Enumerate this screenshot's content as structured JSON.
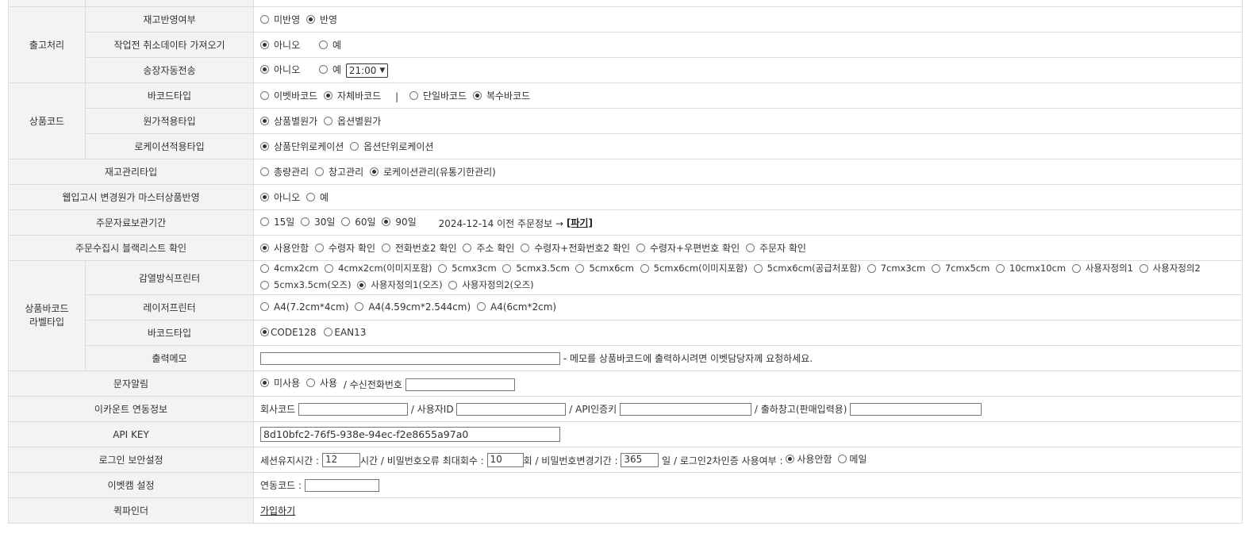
{
  "groups": {
    "shipping": "출고처리",
    "product_code": "상품코드",
    "barcode_label": "상품바코드\n라벨타입"
  },
  "rows": {
    "stock_reflect": {
      "label": "재고반영여부",
      "options": [
        "미반영",
        "반영"
      ]
    },
    "fetch_cancel": {
      "label": "작업전 취소데이타 가져오기",
      "options": [
        "아니오",
        "예"
      ]
    },
    "auto_invoice": {
      "label": "송장자동전송",
      "options": [
        "아니오",
        "예"
      ],
      "time_value": "21:00"
    },
    "barcode_type": {
      "label": "바코드타입",
      "options": [
        "이벳바코드",
        "자체바코드",
        "단일바코드",
        "복수바코드"
      ],
      "divider": "|"
    },
    "cost_type": {
      "label": "원가적용타입",
      "options": [
        "상품별원가",
        "옵션별원가"
      ]
    },
    "location_type": {
      "label": "로케이션적용타입",
      "options": [
        "상품단위로케이션",
        "옵션단위로케이션"
      ]
    },
    "stock_mgmt": {
      "label": "재고관리타입",
      "options": [
        "총량관리",
        "창고관리",
        "로케이션관리(유통기한관리)"
      ]
    },
    "webimport_cost": {
      "label": "웹입고시 변경원가 마스터상품반영",
      "options": [
        "아니오",
        "예"
      ]
    },
    "order_retention": {
      "label": "주문자료보관기간",
      "options": [
        "15일",
        "30일",
        "60일",
        "90일"
      ],
      "note": "2024-12-14 이전 주문정보 →",
      "discard_link": "[파기]"
    },
    "blacklist": {
      "label": "주문수집시 블랙리스트 확인",
      "options": [
        "사용안함",
        "수령자 확인",
        "전화번호2 확인",
        "주소 확인",
        "수령자+전화번호2 확인",
        "수령자+우편번호 확인",
        "주문자 확인"
      ]
    },
    "thermal_printer": {
      "label": "감열방식프린터",
      "options": [
        "4cmx2cm",
        "4cmx2cm(이미지포함)",
        "5cmx3cm",
        "5cmx3.5cm",
        "5cmx6cm",
        "5cmx6cm(이미지포함)",
        "5cmx6cm(공급처포함)",
        "7cmx3cm",
        "7cmx5cm",
        "10cmx10cm",
        "사용자정의1",
        "사용자정의2",
        "5cmx3.5cm(오즈)",
        "사용자정의1(오즈)",
        "사용자정의2(오즈)"
      ]
    },
    "laser_printer": {
      "label": "레이저프린터",
      "options": [
        "A4(7.2cm*4cm)",
        "A4(4.59cm*2.544cm)",
        "A4(6cm*2cm)"
      ]
    },
    "label_barcode_type": {
      "label": "바코드타입",
      "options": [
        "CODE128",
        "EAN13"
      ]
    },
    "print_memo": {
      "label": "출력메모",
      "value": "",
      "hint": "- 메모를 상품바코드에 출력하시려면 이벳담당자께 요청하세요."
    },
    "sms_alert": {
      "label": "문자알림",
      "options": [
        "미사용",
        "사용"
      ],
      "phone_label": "/ 수신전화번호",
      "phone_value": ""
    },
    "ecount": {
      "label": "이카운트 연동정보",
      "company_code": "회사코드",
      "user_id": "/ 사용자ID",
      "api_key": "/ API인증키",
      "warehouse": "/ 출하창고(판매입력용)"
    },
    "api_key": {
      "label": "API KEY",
      "value": "8d10bfc2-76f5-938e-94ec-f2e8655a97a0"
    },
    "login_security": {
      "label": "로그인 보안설정",
      "session_label": "세션유지시간 :",
      "session_value": "12",
      "session_unit": "시간 / 비밀번호오류 최대회수 :",
      "pw_error_value": "10",
      "pw_error_unit": "회 / 비밀번호변경기간 :",
      "pw_change_value": "365",
      "pw_change_unit": "일 / 로그인2차인증 사용여부 :",
      "options": [
        "사용안함",
        "메일"
      ]
    },
    "ebetcam": {
      "label": "이벳캠 설정",
      "code_label": "연동코드 :"
    },
    "quickfinder": {
      "label": "퀵파인더",
      "link": "가입하기"
    }
  }
}
